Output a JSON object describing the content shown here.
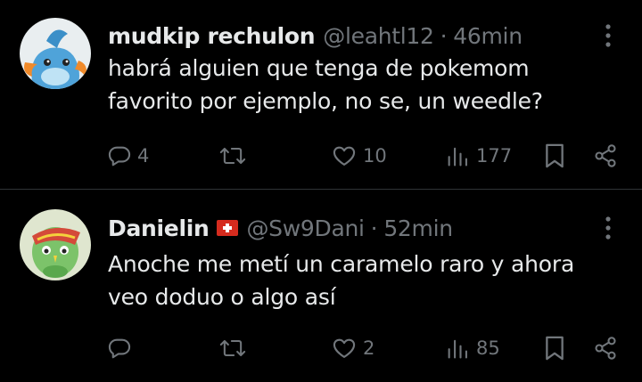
{
  "tweets": [
    {
      "name": "mudkip rechulon",
      "handle": "@leahtl12",
      "separator": "·",
      "time": "46min",
      "text": "habrá alguien que tenga de pokemom favorito por ejemplo, no se, un weedle?",
      "avatar_icon": "mudkip-avatar",
      "replies": "4",
      "retweets": "",
      "likes": "10",
      "views": "177"
    },
    {
      "name": "Danielin",
      "flag_icon": "swiss-flag-icon",
      "handle": "@Sw9Dani",
      "separator": "·",
      "time": "52min",
      "text": "Anoche me metí un caramelo raro y ahora veo doduo o algo así",
      "avatar_icon": "natu-avatar",
      "replies": "",
      "retweets": "",
      "likes": "2",
      "views": "85"
    }
  ],
  "colors": {
    "background": "#000000",
    "primary_text": "#e7e9ea",
    "secondary_text": "#71767b",
    "divider": "#2f3336"
  }
}
